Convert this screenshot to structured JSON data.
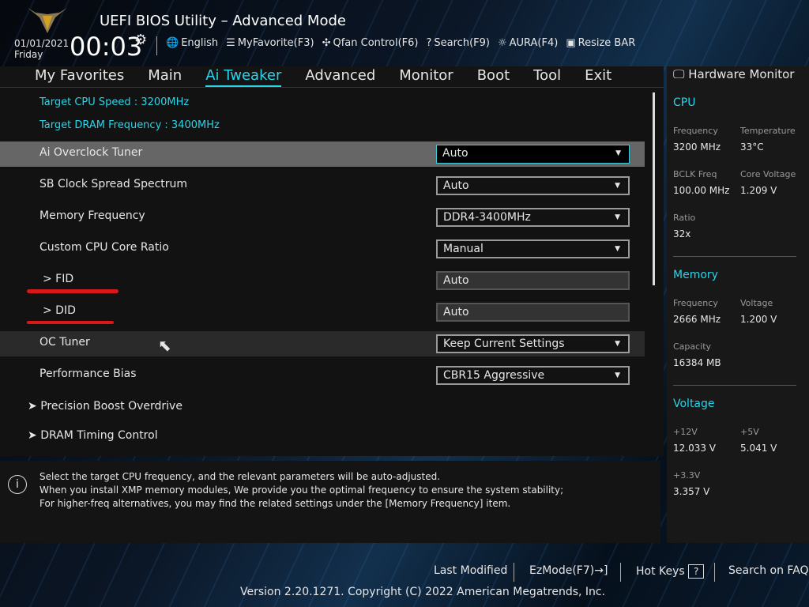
{
  "header": {
    "title": "UEFI BIOS Utility – Advanced Mode",
    "date": "01/01/2021",
    "day": "Friday",
    "time": "00:03",
    "tools": [
      {
        "icon": "globe-icon",
        "glyph": "🌐",
        "label": "English"
      },
      {
        "icon": "favorite-list-icon",
        "glyph": "☰",
        "label": "MyFavorite(F3)"
      },
      {
        "icon": "fan-icon",
        "glyph": "✣",
        "label": "Qfan Control(F6)"
      },
      {
        "icon": "search-help-icon",
        "glyph": "?",
        "label": "Search(F9)"
      },
      {
        "icon": "aura-light-icon",
        "glyph": "☼",
        "label": "AURA(F4)"
      },
      {
        "icon": "resize-bar-icon",
        "glyph": "▣",
        "label": "Resize BAR"
      }
    ]
  },
  "nav": [
    "My Favorites",
    "Main",
    "Ai Tweaker",
    "Advanced",
    "Monitor",
    "Boot",
    "Tool",
    "Exit"
  ],
  "main": {
    "info": [
      "Target CPU Speed : 3200MHz",
      "Target DRAM Frequency : 3400MHz"
    ],
    "settings": [
      {
        "label": "Ai Overclock Tuner",
        "value": "Auto"
      },
      {
        "label": "SB Clock Spread Spectrum",
        "value": "Auto"
      },
      {
        "label": "Memory Frequency",
        "value": "DDR4-3400MHz"
      },
      {
        "label": "Custom CPU Core Ratio",
        "value": "Manual"
      },
      {
        "label": "> FID",
        "value": "Auto"
      },
      {
        "label": "> DID",
        "value": "Auto"
      },
      {
        "label": "OC Tuner",
        "value": "Keep Current Settings"
      },
      {
        "label": "Performance Bias",
        "value": "CBR15 Aggressive"
      }
    ],
    "submenus": [
      "Precision Boost Overdrive",
      "DRAM Timing Control"
    ]
  },
  "help": [
    "Select the target CPU frequency, and the relevant parameters will be auto-adjusted.",
    "When you install XMP memory modules, We provide you the optimal frequency to ensure the system stability;",
    "For higher-freq alternatives, you may find the related settings under the [Memory Frequency] item."
  ],
  "hw": {
    "title": "Hardware Monitor",
    "cpu": {
      "title": "CPU",
      "freq_k": "Frequency",
      "freq": "3200 MHz",
      "temp_k": "Temperature",
      "temp": "33°C",
      "bclk_k": "BCLK Freq",
      "bclk": "100.00 MHz",
      "cv_k": "Core Voltage",
      "cv": "1.209 V",
      "ratio_k": "Ratio",
      "ratio": "32x"
    },
    "mem": {
      "title": "Memory",
      "freq_k": "Frequency",
      "freq": "2666 MHz",
      "volt_k": "Voltage",
      "volt": "1.200 V",
      "cap_k": "Capacity",
      "cap": "16384 MB"
    },
    "volt": {
      "title": "Voltage",
      "v12_k": "+12V",
      "v12": "12.033 V",
      "v5_k": "+5V",
      "v5": "5.041 V",
      "v33_k": "+3.3V",
      "v33": "3.357 V"
    }
  },
  "footer": {
    "last_modified": "Last Modified",
    "ezmode": "EzMode(F7)",
    "ezmode_icon": "→]",
    "hotkeys": "Hot Keys",
    "hotkeys_icon": "?",
    "faq": "Search on FAQ",
    "version": "Version 2.20.1271. Copyright (C) 2022 American Megatrends, Inc."
  }
}
